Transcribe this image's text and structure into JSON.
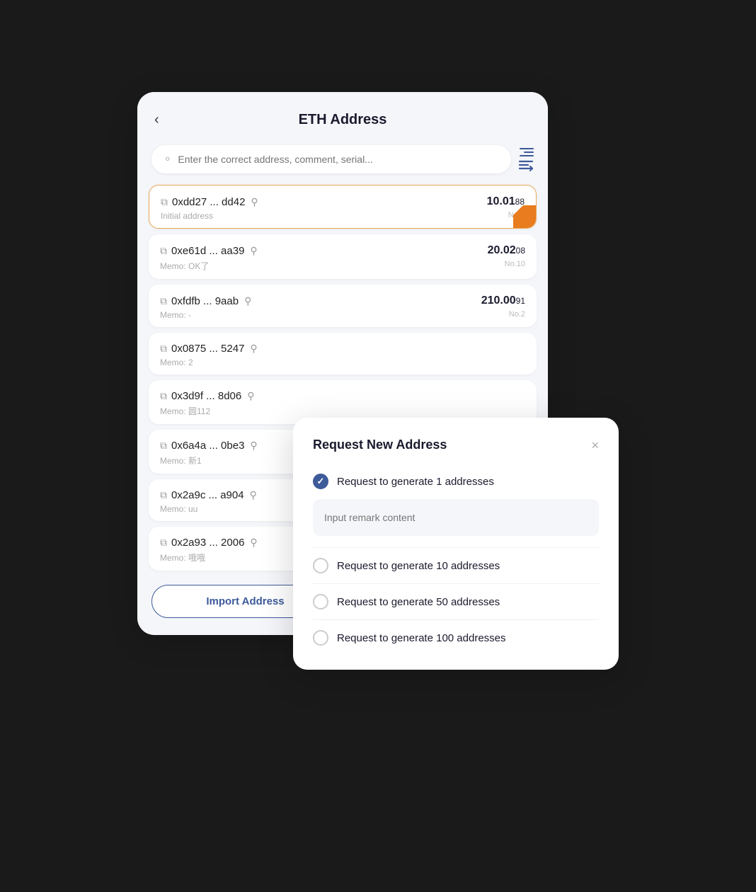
{
  "header": {
    "back_label": "‹",
    "title": "ETH Address"
  },
  "search": {
    "placeholder": "Enter the correct address, comment, serial..."
  },
  "addresses": [
    {
      "hash": "0xdd27 ... dd42",
      "memo": "Initial address",
      "balance_main": "10.01",
      "balance_decimal": "88",
      "number": "No.0",
      "active": true
    },
    {
      "hash": "0xe61d ... aa39",
      "memo": "Memo: OK了",
      "balance_main": "20.02",
      "balance_decimal": "08",
      "number": "No.10",
      "active": false
    },
    {
      "hash": "0xfdfb ... 9aab",
      "memo": "Memo: -",
      "balance_main": "210.00",
      "balance_decimal": "91",
      "number": "No.2",
      "active": false
    },
    {
      "hash": "0x0875 ... 5247",
      "memo": "Memo: 2",
      "balance_main": "",
      "balance_decimal": "",
      "number": "",
      "active": false
    },
    {
      "hash": "0x3d9f ... 8d06",
      "memo": "Memo: 圆112",
      "balance_main": "",
      "balance_decimal": "",
      "number": "",
      "active": false
    },
    {
      "hash": "0x6a4a ... 0be3",
      "memo": "Memo: 新1",
      "balance_main": "",
      "balance_decimal": "",
      "number": "",
      "active": false
    },
    {
      "hash": "0x2a9c ... a904",
      "memo": "Memo: uu",
      "balance_main": "",
      "balance_decimal": "",
      "number": "",
      "active": false
    },
    {
      "hash": "0x2a93 ... 2006",
      "memo": "Memo: 哦哦",
      "balance_main": "",
      "balance_decimal": "",
      "number": "",
      "active": false
    }
  ],
  "footer": {
    "import_label": "Import Address",
    "request_label": "Request New Address"
  },
  "modal": {
    "title": "Request New Address",
    "close_label": "×",
    "remark_placeholder": "Input remark content",
    "options": [
      {
        "label": "Request to generate 1 addresses",
        "checked": true
      },
      {
        "label": "Request to generate 10 addresses",
        "checked": false
      },
      {
        "label": "Request to generate 50 addresses",
        "checked": false
      },
      {
        "label": "Request to generate 100 addresses",
        "checked": false
      }
    ]
  }
}
